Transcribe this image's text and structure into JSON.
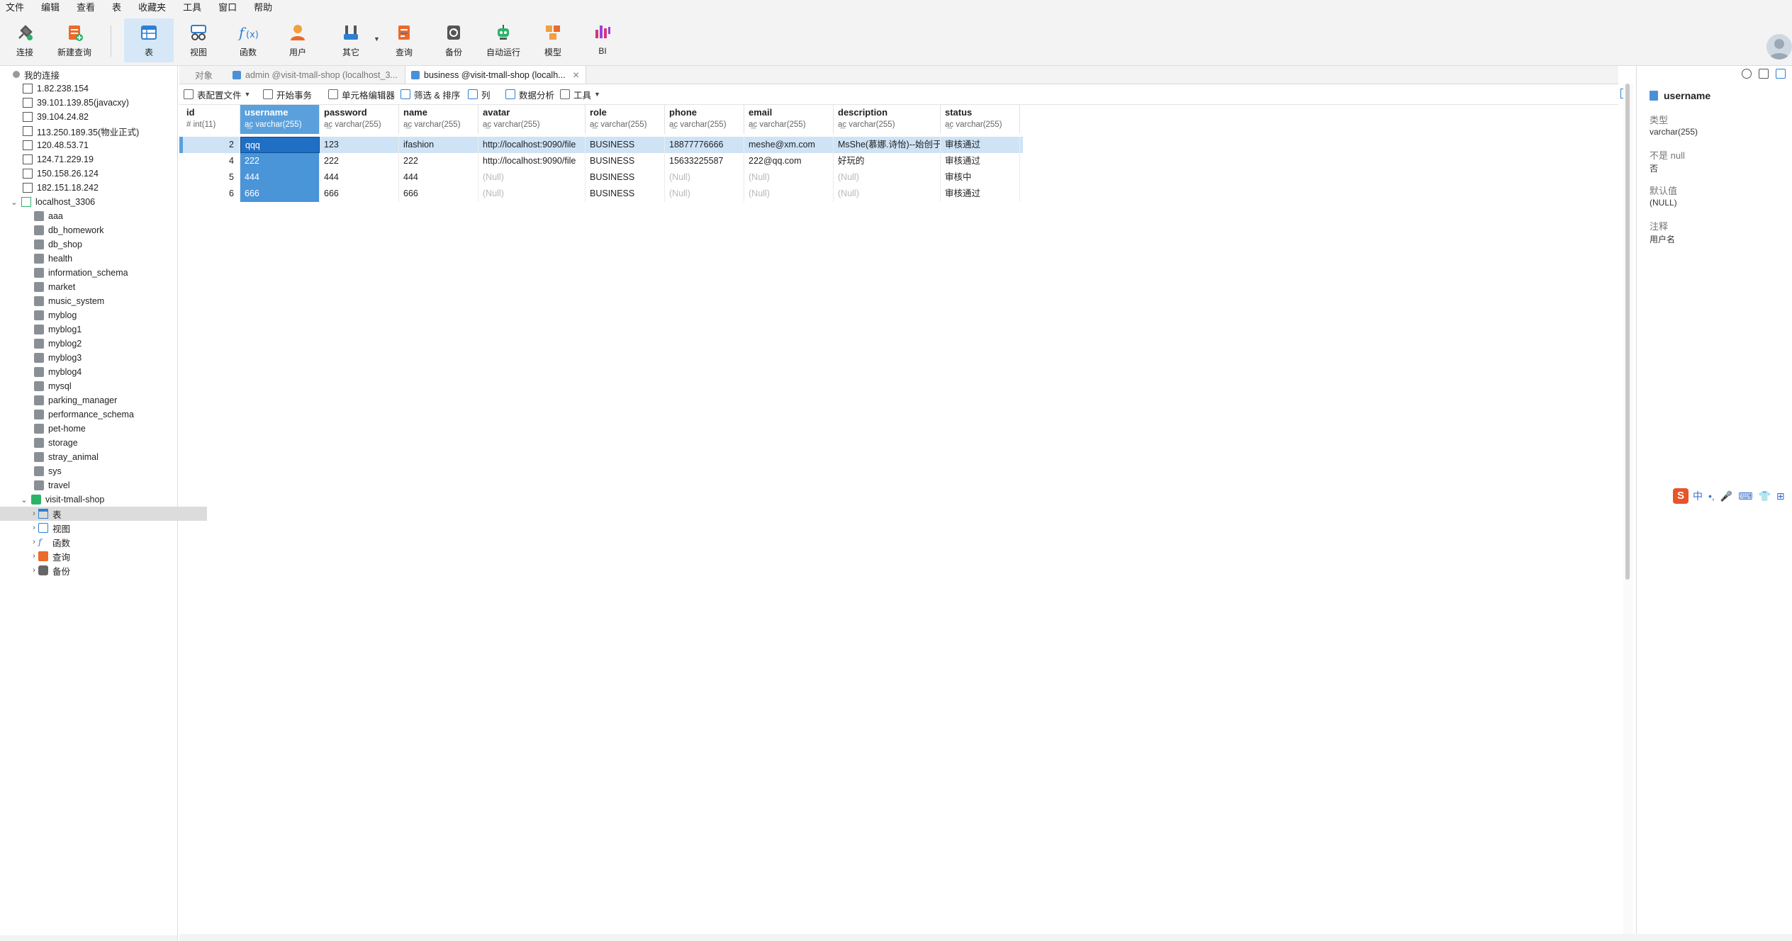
{
  "menubar": {
    "items": [
      "文件",
      "编辑",
      "查看",
      "表",
      "收藏夹",
      "工具",
      "窗口",
      "帮助"
    ]
  },
  "toolbar": {
    "buttons": [
      {
        "label": "连接",
        "icon": "plug-icon"
      },
      {
        "label": "新建查询",
        "icon": "new-query-icon"
      },
      {
        "label": "表",
        "icon": "table-icon",
        "active": true
      },
      {
        "label": "视图",
        "icon": "view-icon"
      },
      {
        "label": "函数",
        "icon": "function-icon"
      },
      {
        "label": "用户",
        "icon": "user-icon"
      },
      {
        "label": "其它",
        "icon": "tools-icon"
      },
      {
        "label": "查询",
        "icon": "query-icon"
      },
      {
        "label": "备份",
        "icon": "backup-icon"
      },
      {
        "label": "自动运行",
        "icon": "robot-icon"
      },
      {
        "label": "模型",
        "icon": "model-icon"
      },
      {
        "label": "BI",
        "icon": "bi-icon"
      }
    ],
    "accent_color": "#2f7fd1"
  },
  "sidebar": {
    "root_label": "我的连接",
    "connections": [
      "1.82.238.154",
      "39.101.139.85(javacxy)",
      "39.104.24.82",
      "113.250.189.35(物业正式)",
      "120.48.53.71",
      "124.71.229.19",
      "150.158.26.124",
      "182.151.18.242"
    ],
    "local_connection": "localhost_3306",
    "databases": [
      "aaa",
      "db_homework",
      "db_shop",
      "health",
      "information_schema",
      "market",
      "music_system",
      "myblog",
      "myblog1",
      "myblog2",
      "myblog3",
      "myblog4",
      "mysql",
      "parking_manager",
      "performance_schema",
      "pet-home",
      "storage",
      "stray_animal",
      "sys",
      "travel"
    ],
    "open_database": "visit-tmall-shop",
    "open_database_children": [
      "表",
      "视图",
      "函数",
      "查询",
      "备份"
    ]
  },
  "tabs": {
    "objects_label": "对象",
    "items": [
      {
        "label": "admin @visit-tmall-shop (localhost_3...",
        "active": false
      },
      {
        "label": "business @visit-tmall-shop (localh...",
        "active": true
      }
    ]
  },
  "datatoolbar": {
    "config_file": "表配置文件",
    "begin_transaction": "开始事务",
    "cell_editor": "单元格编辑器",
    "filter_sort": "筛选 & 排序",
    "columns": "列",
    "data_analysis": "数据分析",
    "tools": "工具"
  },
  "grid": {
    "columns": [
      {
        "name": "id",
        "type": "int(11)"
      },
      {
        "name": "username",
        "type": "varchar(255)"
      },
      {
        "name": "password",
        "type": "varchar(255)"
      },
      {
        "name": "name",
        "type": "varchar(255)"
      },
      {
        "name": "avatar",
        "type": "varchar(255)"
      },
      {
        "name": "role",
        "type": "varchar(255)"
      },
      {
        "name": "phone",
        "type": "varchar(255)"
      },
      {
        "name": "email",
        "type": "varchar(255)"
      },
      {
        "name": "description",
        "type": "varchar(255)"
      },
      {
        "name": "status",
        "type": "varchar(255)"
      }
    ],
    "rows": [
      [
        "2",
        "qqq",
        "123",
        "ifashion",
        "http://localhost:9090/file",
        "BUSINESS",
        "18877776666",
        "meshe@xm.com",
        "MsShe(慕娜.诗怡)--始创于",
        "审核通过"
      ],
      [
        "4",
        "222",
        "222",
        "222",
        "http://localhost:9090/file",
        "BUSINESS",
        "15633225587",
        "222@qq.com",
        "好玩的",
        "审核通过"
      ],
      [
        "5",
        "444",
        "444",
        "444",
        "(Null)",
        "BUSINESS",
        "(Null)",
        "(Null)",
        "(Null)",
        "审核中"
      ],
      [
        "6",
        "666",
        "666",
        "666",
        "(Null)",
        "BUSINESS",
        "(Null)",
        "(Null)",
        "(Null)",
        "审核通过"
      ]
    ],
    "null_text": "(Null)",
    "selected_column": "username",
    "highlight_color": "#cfe3f6",
    "selection_color": "#4a94d8"
  },
  "rightpanel": {
    "title": "username",
    "fields": [
      {
        "label": "类型",
        "value": "varchar(255)"
      },
      {
        "label": "不是 null",
        "value": "否"
      },
      {
        "label": "默认值",
        "value": "(NULL)"
      },
      {
        "label": "注释",
        "value": "用户名"
      }
    ]
  },
  "ime": {
    "logo": "S",
    "items": [
      "中",
      "•,",
      "🎤",
      "⌨",
      "👕",
      "⊞"
    ]
  }
}
